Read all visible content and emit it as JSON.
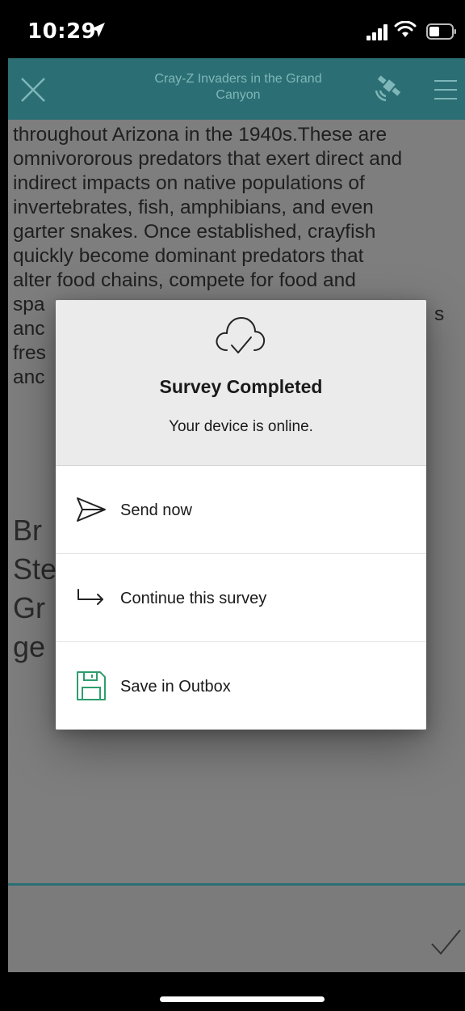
{
  "status_bar": {
    "time": "10:29",
    "icons": [
      "location-arrow-icon",
      "signal-icon",
      "wifi-icon",
      "battery-icon"
    ]
  },
  "header": {
    "title_line1": "Cray-Z Invaders in the Grand",
    "title_line2": "Canyon",
    "icons": [
      "close-icon",
      "gps-satellite-icon",
      "menu-icon"
    ],
    "bar_color": "#2b6f74"
  },
  "content": {
    "lines": [
      "throughout Arizona in the 1940s.These are",
      "omnivororous predators that exert direct and",
      "indirect impacts on native populations of",
      "invertebrates, fish, amphibians, and even",
      "garter snakes. Once established, crayfish",
      "quickly become dominant predators that",
      "alter food chains, compete for food and",
      "spa",
      "anc",
      "fres",
      "anc"
    ],
    "right_edge_fragment": "s",
    "heading_lines": [
      "Br",
      "Ste",
      "Gr",
      "ge"
    ]
  },
  "dialog": {
    "title": "Survey Completed",
    "subtitle": "Your device is online.",
    "header_icon": "cloud-check-icon",
    "options": [
      {
        "label": "Send now",
        "icon": "send-icon"
      },
      {
        "label": "Continue this survey",
        "icon": "continue-arrow-icon"
      },
      {
        "label": "Save in Outbox",
        "icon": "save-disk-icon"
      }
    ],
    "accent_color": "#2e9e6e"
  },
  "footer": {
    "icon": "checkmark-icon"
  }
}
